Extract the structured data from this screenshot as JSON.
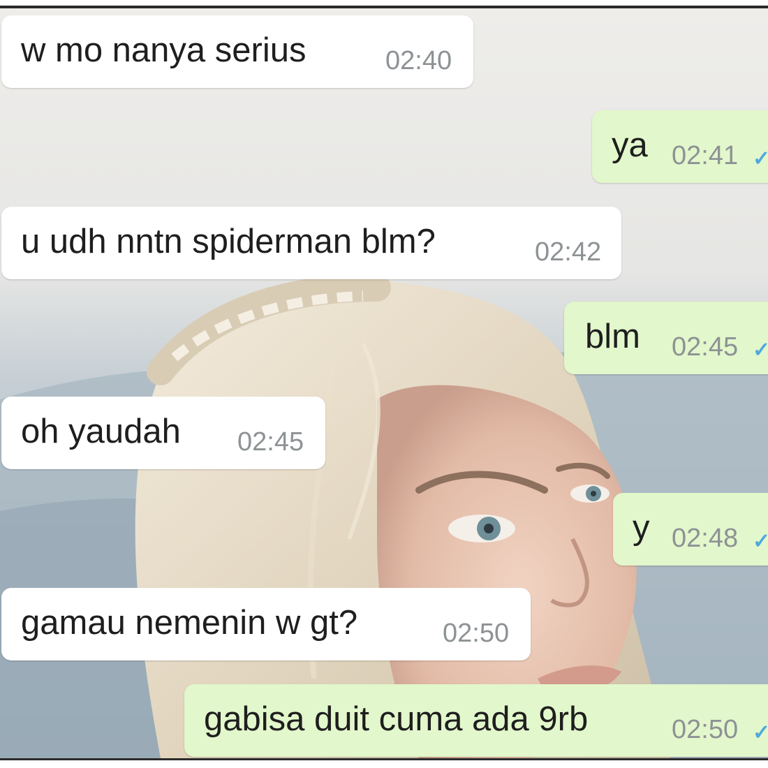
{
  "chat": {
    "messages": [
      {
        "direction": "incoming",
        "text": "w mo nanya serius",
        "time": "02:40"
      },
      {
        "direction": "outgoing",
        "text": "ya",
        "time": "02:41",
        "status_icon": "check-icon"
      },
      {
        "direction": "incoming",
        "text": "u udh nntn spiderman blm?",
        "time": "02:42"
      },
      {
        "direction": "outgoing",
        "text": "blm",
        "time": "02:45",
        "status_icon": "check-icon"
      },
      {
        "direction": "incoming",
        "text": "oh yaudah",
        "time": "02:45"
      },
      {
        "direction": "outgoing",
        "text": "y",
        "time": "02:48",
        "status_icon": "check-icon"
      },
      {
        "direction": "incoming",
        "text": "gamau nemenin w gt?",
        "time": "02:50"
      },
      {
        "direction": "outgoing",
        "text": "gabisa duit cuma ada 9rb",
        "time": "02:50",
        "status_icon": "check-icon"
      }
    ]
  },
  "colors": {
    "incoming_bubble": "#ffffff",
    "outgoing_bubble": "#e2f7cb",
    "timestamp": "#8d9294",
    "tick": "#4fa8de"
  }
}
